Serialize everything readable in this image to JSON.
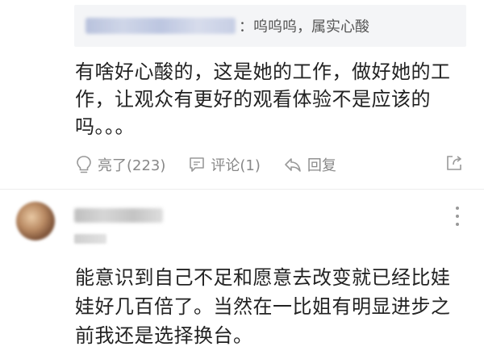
{
  "reply": {
    "quoted_text": "：呜呜呜，属实心酸",
    "text": "有啥好心酸的，这是她的工作，做好她的工作，让观众有更好的观看体验不是应该的吗。。。",
    "actions": {
      "like_label": "亮了(223)",
      "comment_label": "评论(1)",
      "reply_label": "回复"
    }
  },
  "comment": {
    "text": "能意识到自己不足和愿意去改变就已经比娃娃好几百倍了。当然在一比姐有明显进步之前我还是选择换台。"
  },
  "icons": {
    "like": "lightbulb-icon",
    "comment": "comment-bubble-icon",
    "reply": "reply-arrow-icon",
    "share": "share-icon",
    "more": "more-vertical-icon"
  },
  "colors": {
    "text": "#222222",
    "secondary": "#888888",
    "quote_bg": "#f4f5f7"
  }
}
